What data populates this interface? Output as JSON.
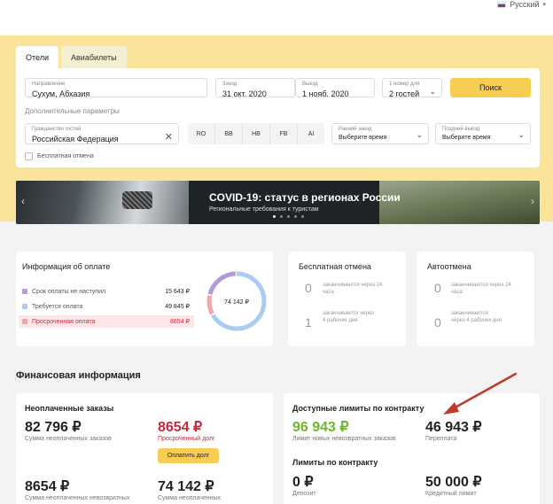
{
  "language": {
    "label": "Русский",
    "icon": "russia-flag-icon"
  },
  "tabs": [
    {
      "label": "Отели",
      "active": true
    },
    {
      "label": "Авиабилеты",
      "active": false
    }
  ],
  "search": {
    "destination": {
      "label": "Направление",
      "value": "Сухум, Абхазия"
    },
    "checkin": {
      "label": "Заезд",
      "value": "31 окт. 2020"
    },
    "checkout": {
      "label": "Выезд",
      "value": "1 нояб. 2020"
    },
    "rooms": {
      "label": "1 номер для",
      "value": "2 гостей"
    },
    "search_button": "Поиск",
    "additional_params": "Дополнительные параметры",
    "citizenship": {
      "label": "Гражданство гостей",
      "value": "Российская Федерация"
    },
    "meal_options": [
      "RO",
      "BB",
      "HB",
      "FB",
      "AI"
    ],
    "early_checkin": {
      "label": "Ранний заезд",
      "value": "Выберите время"
    },
    "late_checkout": {
      "label": "Поздний выезд",
      "value": "Выберите время"
    },
    "free_cancel": "Бесплатная отмена"
  },
  "banner": {
    "title": "COVID-19: статус в регионах России",
    "subtitle": "Региональные требования к туристам",
    "slide_count": 5,
    "active_slide": 0
  },
  "payment_info": {
    "title": "Информация об оплате",
    "rows": [
      {
        "label": "Срок оплаты не наступил",
        "amount": "15 643 ₽",
        "color": "#b49ad6"
      },
      {
        "label": "Требуется оплата",
        "amount": "49 845 ₽",
        "color": "#a9ccef"
      },
      {
        "label": "Просроченная оплата",
        "amount": "8654 ₽",
        "color": "#f3a3a9"
      }
    ],
    "donut": {
      "total": "74 142 ₽",
      "values": [
        15643,
        49845,
        8654
      ],
      "colors": [
        "#b49ad6",
        "#a9ccef",
        "#f3a3a9"
      ]
    }
  },
  "free_cancellation": {
    "title": "Бесплатная отмена",
    "items": [
      {
        "count": "0",
        "text": "заканчиваются через 24 часа"
      },
      {
        "count": "1",
        "text": "заканчивается через 4 рабочих дня"
      }
    ]
  },
  "auto_cancellation": {
    "title": "Автоотмена",
    "items": [
      {
        "count": "0",
        "text": "заканчиваются через 24 часа"
      },
      {
        "count": "0",
        "text": "заканчиваются через 4 рабочих дня"
      }
    ]
  },
  "financial": {
    "title": "Финансовая информация",
    "unpaid": {
      "title": "Неоплаченные заказы",
      "sum": "82 796 ₽",
      "sum_caption": "Сумма неоплаченных заказов",
      "overdue": "8654 ₽",
      "overdue_caption": "Просроченный долг",
      "pay_button": "Оплатить долг",
      "nonrefundable": "8654 ₽",
      "nonrefundable_caption": "Сумма неоплаченных невозвратных",
      "other": "74 142 ₽",
      "other_caption": "Сумма неоплаченных"
    },
    "limits": {
      "title": "Доступные лимиты по контракту",
      "available": "96 943 ₽",
      "available_caption": "Лимит новых невозвратных заказов",
      "overpay": "46 943 ₽",
      "overpay_caption": "Переплата",
      "contract_title": "Лимиты по контракту",
      "deposit": "0 ₽",
      "deposit_caption": "Депозит",
      "credit": "50 000 ₽",
      "credit_caption": "Кредитный лимит"
    }
  },
  "colors": {
    "accent": "#f7cd55",
    "hero_bg": "#fbe39a",
    "overdue": "#c8283c",
    "positive": "#6cb829",
    "annotation_arrow": "#c0392b"
  }
}
